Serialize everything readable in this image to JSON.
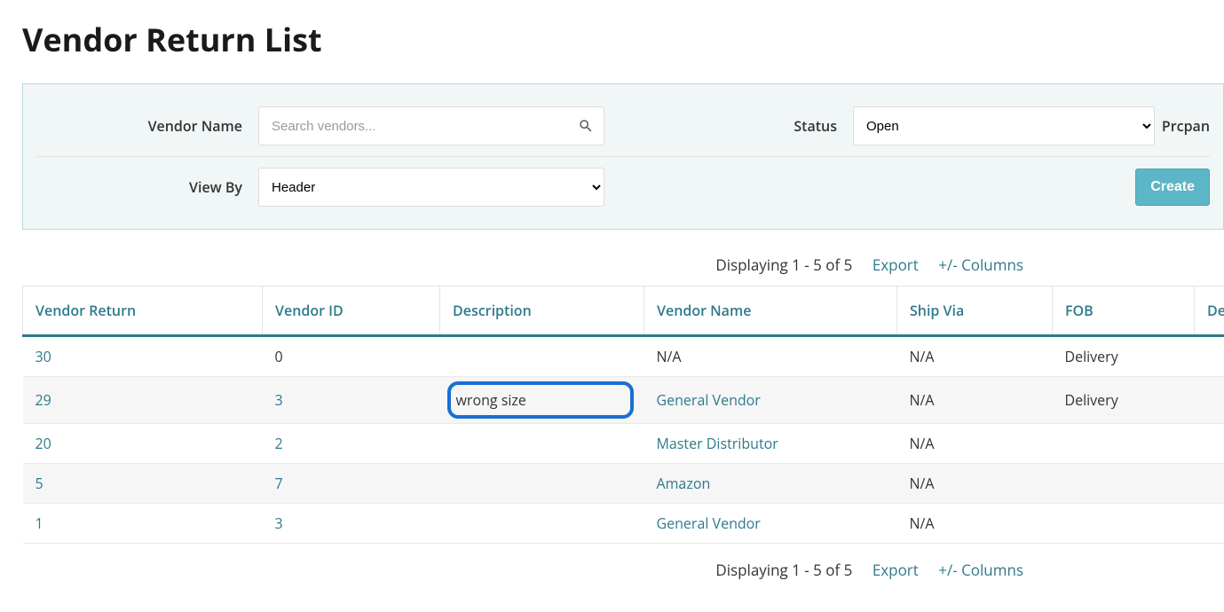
{
  "page_title": "Vendor Return List",
  "filters": {
    "vendor_name_label": "Vendor Name",
    "vendor_search_placeholder": "Search vendors...",
    "status_label": "Status",
    "status_value": "Open",
    "status_options": [
      "Open"
    ],
    "prcpan_label": "Prcpan",
    "view_by_label": "View By",
    "view_by_value": "Header",
    "view_by_options": [
      "Header"
    ],
    "create_label": "Create"
  },
  "toolbar": {
    "displaying": "Displaying 1 - 5 of 5",
    "export_label": "Export",
    "columns_label": "+/- Columns"
  },
  "columns": {
    "vendor_return": "Vendor Return",
    "vendor_id": "Vendor ID",
    "description": "Description",
    "vendor_name": "Vendor Name",
    "ship_via": "Ship Via",
    "fob": "FOB",
    "del": "Del"
  },
  "rows": [
    {
      "vendor_return": "30",
      "vendor_id": "0",
      "vendor_id_link": false,
      "description": "",
      "vendor_name": "N/A",
      "vendor_name_link": false,
      "ship_via": "N/A",
      "fob": "Delivery",
      "highlight": false
    },
    {
      "vendor_return": "29",
      "vendor_id": "3",
      "vendor_id_link": true,
      "description": "wrong size",
      "vendor_name": "General Vendor",
      "vendor_name_link": true,
      "ship_via": "N/A",
      "fob": "Delivery",
      "highlight": true
    },
    {
      "vendor_return": "20",
      "vendor_id": "2",
      "vendor_id_link": true,
      "description": "",
      "vendor_name": "Master Distributor",
      "vendor_name_link": true,
      "ship_via": "N/A",
      "fob": "",
      "highlight": false
    },
    {
      "vendor_return": "5",
      "vendor_id": "7",
      "vendor_id_link": true,
      "description": "",
      "vendor_name": "Amazon",
      "vendor_name_link": true,
      "ship_via": "N/A",
      "fob": "",
      "highlight": false
    },
    {
      "vendor_return": "1",
      "vendor_id": "3",
      "vendor_id_link": true,
      "description": "",
      "vendor_name": "General Vendor",
      "vendor_name_link": true,
      "ship_via": "N/A",
      "fob": "",
      "highlight": false
    }
  ]
}
